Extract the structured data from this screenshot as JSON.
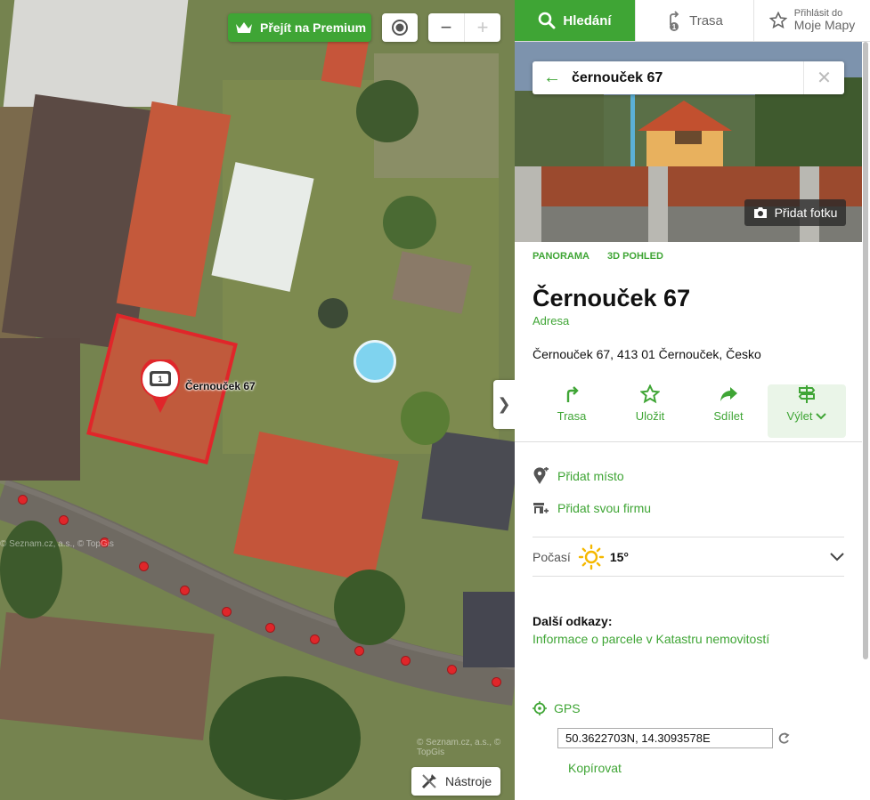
{
  "map": {
    "premium_label": "Přejít na Premium",
    "pin_label": "Černouček 67",
    "tools_label": "Nástroje",
    "copyright_1": "© Seznam.cz, a.s., © TopGis",
    "copyright_2": "© Seznam.cz, a.s., © TopGis",
    "zoom_out": "−",
    "zoom_in": "+"
  },
  "nav": {
    "search_label": "Hledání",
    "route_label": "Trasa",
    "login_small": "Přihlásit do",
    "login_big": "Moje Mapy"
  },
  "search": {
    "value": "černouček 67"
  },
  "photo": {
    "add_label": "Přidat fotku"
  },
  "place": {
    "mini_links": [
      "PANORAMA",
      "3D POHLED"
    ],
    "title": "Černouček 67",
    "subtitle": "Adresa",
    "address": "Černouček 67, 413 01 Černouček, Česko"
  },
  "actions": {
    "route": "Trasa",
    "save": "Uložit",
    "share": "Sdílet",
    "trip": "Výlet"
  },
  "links": {
    "add_place": "Přidat místo",
    "add_company": "Přidat svou firmu"
  },
  "weather": {
    "label": "Počasí",
    "temp": "15°"
  },
  "more": {
    "heading": "Další odkazy:",
    "cadastre": "Informace o parcele v Katastru nemovitostí"
  },
  "gps": {
    "label": "GPS",
    "value": "50.3622703N, 14.3093578E",
    "copy_label": "Kopírovat"
  },
  "colors": {
    "accent": "#3fa535",
    "parcel": "#e0262a"
  }
}
